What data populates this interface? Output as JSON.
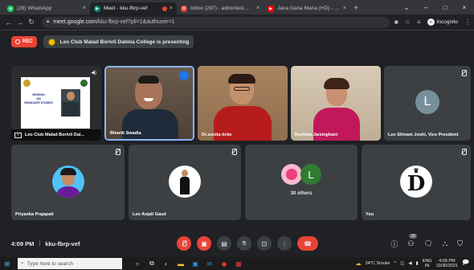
{
  "browser": {
    "tabs": [
      {
        "title": "(28) WhatsApp",
        "icon": "whatsapp-icon",
        "color": "#25d366"
      },
      {
        "title": "Meet - kku-fbrp-vef",
        "icon": "meet-icon",
        "color": "#00897b",
        "active": true
      },
      {
        "title": "Inbox (287) - admintest@dalmi...",
        "icon": "gmail-icon",
        "color": "#ea4335"
      },
      {
        "title": "Jana Gana Mana (HD) - National...",
        "icon": "youtube-icon",
        "color": "#ff0000"
      }
    ],
    "new_tab": "+",
    "url_host": "meet.google.com",
    "url_path": "/kku-fbrp-vef?pli=1&authuser=1",
    "incognito_label": "Incognito"
  },
  "meet": {
    "rec_label": "REC",
    "presenting_text": "Leo Club Malad Borivli Dalmia College is presenting",
    "participants": [
      {
        "name": "Leo Club Malad Borivli Dal...",
        "type": "presentation"
      },
      {
        "name": "Bhavik Swadia",
        "type": "video"
      },
      {
        "name": "Dr.sunita ticke",
        "type": "video"
      },
      {
        "name": "Reshma Jaisinghani",
        "type": "video"
      },
      {
        "name": "Leo Shivam Joshi, Vice President",
        "type": "avatar",
        "initial": "L",
        "color": "#78909c"
      },
      {
        "name": "Priyanka Prajapati",
        "type": "photo"
      },
      {
        "name": "Leo Anjali Gaud",
        "type": "photo"
      },
      {
        "name": "30 others",
        "type": "others",
        "initial": "L",
        "color": "#2e7d32"
      },
      {
        "name": "You",
        "type": "photo"
      }
    ],
    "slide_lines": [
      "SESSION",
      "ON",
      "GRADUATE STUDIES"
    ],
    "time_label": "4:09 PM",
    "meeting_code": "kku-fbrp-vef",
    "people_count": "38"
  },
  "taskbar": {
    "search_placeholder": "Type here to search",
    "weather": "34°C Smoke",
    "lang": "ENG",
    "lang_region": "IN",
    "time": "4:09 PM",
    "date": "10/30/2021"
  },
  "colors": {
    "accent": "#8ab4f8",
    "danger": "#ea4335",
    "bg": "#202124",
    "tile": "#3c4043"
  }
}
